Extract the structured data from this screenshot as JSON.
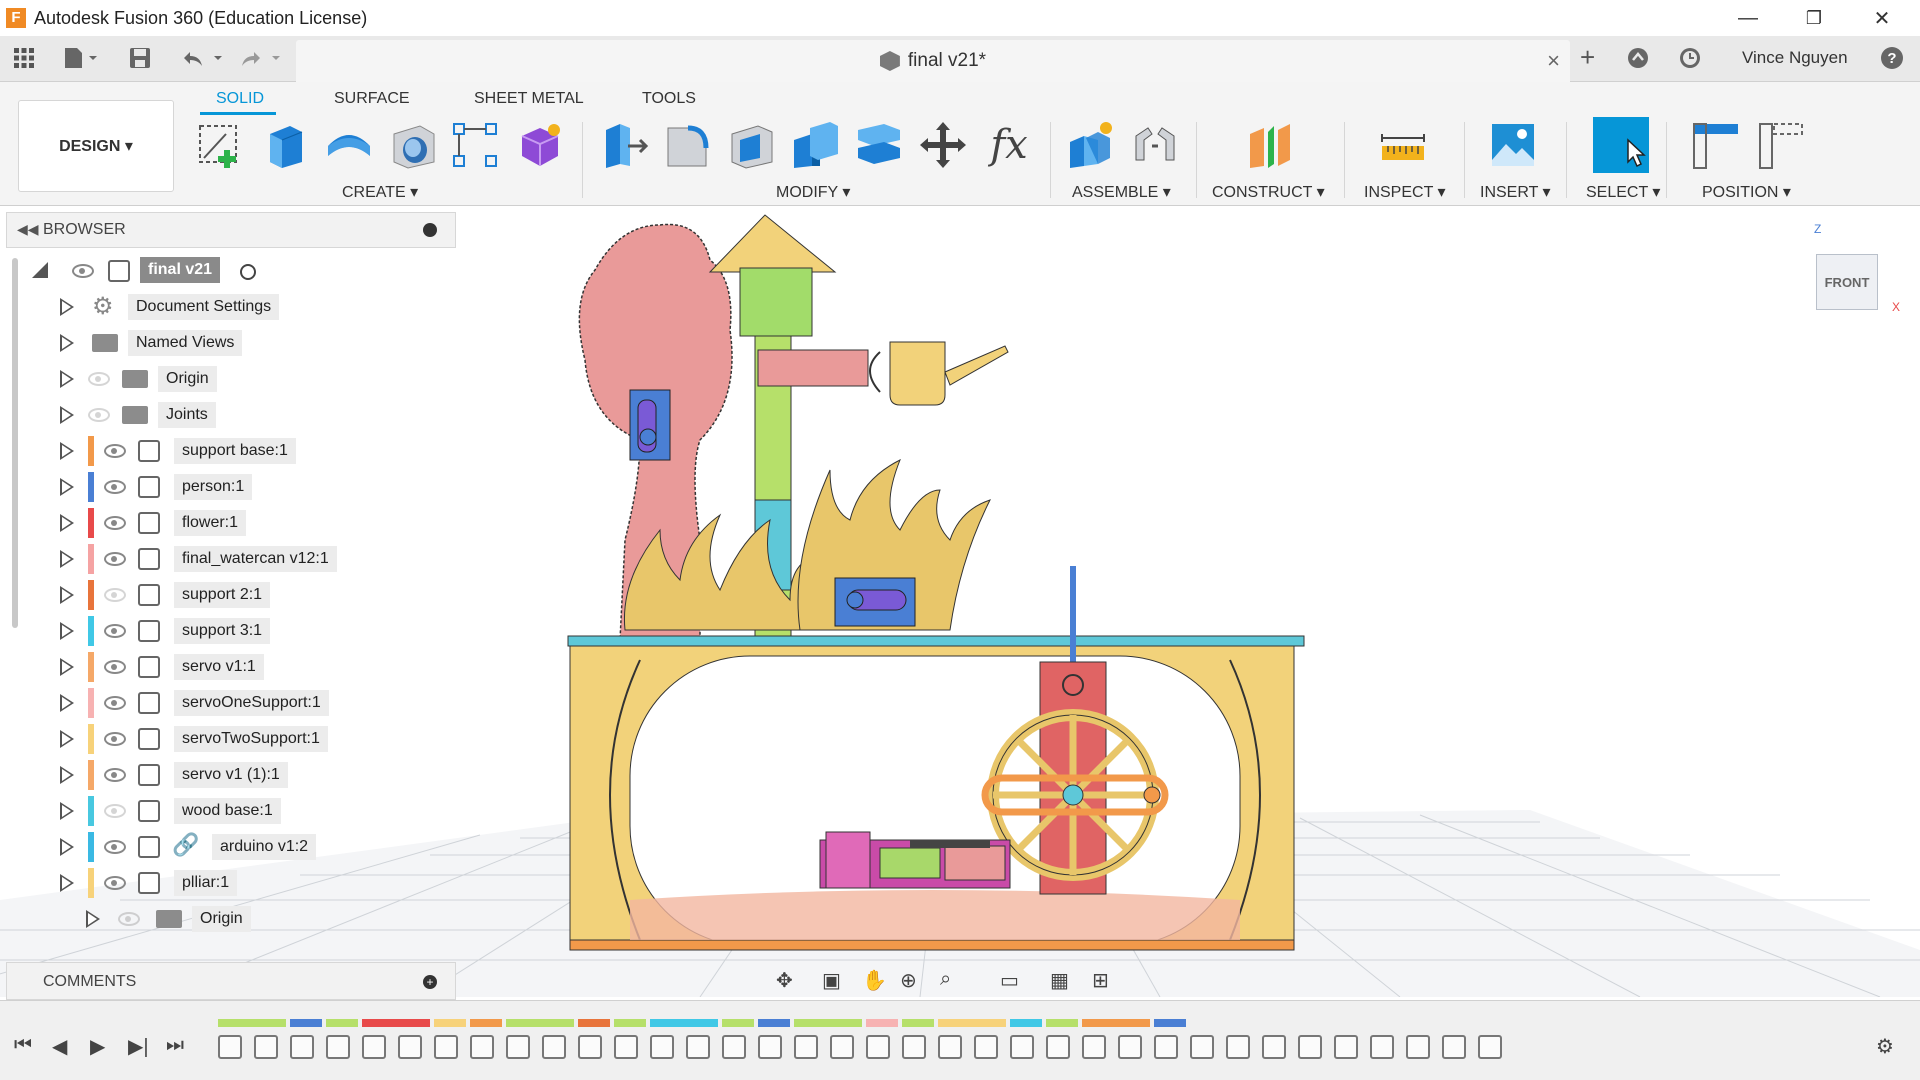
{
  "window": {
    "title": "Autodesk Fusion 360 (Education License)",
    "logo_letter": "F",
    "minimize": "—",
    "restore": "❐",
    "close": "✕"
  },
  "quick_access": {
    "document_tab": "final v21*",
    "user": "Vince Nguyen",
    "tab_close": "×",
    "new_tab": "+",
    "help": "?"
  },
  "ribbon": {
    "workspace": "DESIGN ▾",
    "tabs": [
      "SOLID",
      "SURFACE",
      "SHEET METAL",
      "TOOLS"
    ],
    "active_tab": "SOLID",
    "groups": [
      "CREATE ▾",
      "MODIFY ▾",
      "ASSEMBLE ▾",
      "CONSTRUCT ▾",
      "INSPECT ▾",
      "INSERT ▾",
      "SELECT ▾",
      "POSITION ▾"
    ],
    "fx_label": "fx"
  },
  "browser": {
    "title": "BROWSER",
    "root": "final v21",
    "items": [
      {
        "label": "Document Settings",
        "color": "",
        "eye": "none",
        "icon": "gear-icon"
      },
      {
        "label": "Named Views",
        "color": "",
        "eye": "none",
        "icon": "folder-icon"
      },
      {
        "label": "Origin",
        "color": "",
        "eye": "off",
        "icon": "folder-icon"
      },
      {
        "label": "Joints",
        "color": "",
        "eye": "off",
        "icon": "folder-icon"
      },
      {
        "label": "support base:1",
        "color": "#f2994a",
        "eye": "on",
        "icon": "component-icon"
      },
      {
        "label": "person:1",
        "color": "#4a7fd4",
        "eye": "on",
        "icon": "component-icon"
      },
      {
        "label": "flower:1",
        "color": "#e84a4a",
        "eye": "on",
        "icon": "component-icon"
      },
      {
        "label": "final_watercan v12:1",
        "color": "#f5a3a3",
        "eye": "on",
        "icon": "component-icon"
      },
      {
        "label": "support 2:1",
        "color": "#e8743b",
        "eye": "off",
        "icon": "body-icon"
      },
      {
        "label": "support 3:1",
        "color": "#40c8e6",
        "eye": "on",
        "icon": "body-icon"
      },
      {
        "label": "servo v1:1",
        "color": "#f5a868",
        "eye": "on",
        "icon": "component-icon"
      },
      {
        "label": "servoOneSupport:1",
        "color": "#f7b2b2",
        "eye": "on",
        "icon": "body-icon"
      },
      {
        "label": "servoTwoSupport:1",
        "color": "#f7d27a",
        "eye": "on",
        "icon": "component-icon"
      },
      {
        "label": "servo v1 (1):1",
        "color": "#f5a868",
        "eye": "on",
        "icon": "component-icon"
      },
      {
        "label": "wood base:1",
        "color": "#48c8e0",
        "eye": "off",
        "icon": "body-icon"
      },
      {
        "label": "arduino v1:2",
        "color": "#3ab9e3",
        "eye": "on",
        "icon": "linked-component-icon"
      },
      {
        "label": "plliar:1",
        "color": "#f7d27a",
        "eye": "on",
        "icon": "body-icon"
      }
    ],
    "sub_origin": "Origin"
  },
  "comments": {
    "title": "COMMENTS"
  },
  "viewcube": {
    "face": "FRONT",
    "axis_z": "Z",
    "axis_x": "X"
  },
  "colors": {
    "accent": "#0696d7",
    "tree": "#e99a99",
    "grass": "#e8c66a",
    "table_top": "#5ec8d8",
    "frame": "#f2d27a",
    "wheel": "#f2d27a",
    "post": "#b6e06a"
  },
  "timeline_colors": [
    "#b6e06a",
    "#4a7fd4",
    "#b6e06a",
    "#e84a4a",
    "#f7d27a",
    "#f2994a",
    "#b6e06a",
    "#e8743b",
    "#b6e06a",
    "#40c8e6",
    "#b6e06a",
    "#4a7fd4",
    "#b6e06a",
    "#f7b2b2",
    "#b6e06a",
    "#f7d27a",
    "#40c8e6",
    "#b6e06a",
    "#f2994a",
    "#4a7fd4"
  ]
}
